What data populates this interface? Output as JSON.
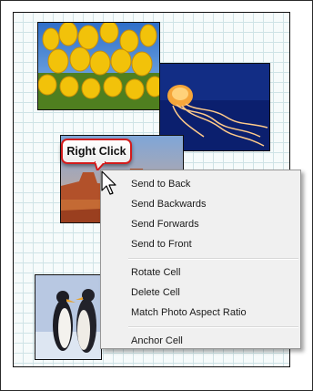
{
  "tooltip": {
    "text": "Right Click"
  },
  "context_menu": {
    "items": [
      "Send to Back",
      "Send Backwards",
      "Send Forwards",
      "Send to Front",
      "Rotate Cell",
      "Delete Cell",
      "Match Photo Aspect Ratio",
      "Anchor Cell"
    ]
  },
  "photos": [
    "tulips-photo",
    "jellyfish-photo",
    "desert-photo",
    "penguins-photo"
  ],
  "colors": {
    "tooltip_border": "#d31b1b",
    "grid_line": "#cfe3e6",
    "menu_bg": "#f0f0f0"
  }
}
